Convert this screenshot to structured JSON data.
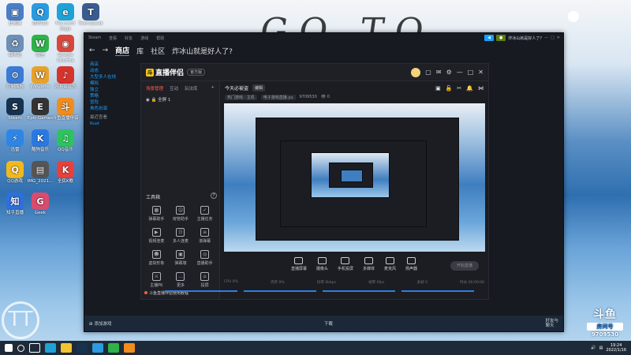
{
  "desktop": {
    "icons": [
      {
        "label": "此电脑",
        "color": "#4a7ec8",
        "glyph": "▣"
      },
      {
        "label": "腾讯QQ",
        "color": "#2a9be0",
        "glyph": "Q"
      },
      {
        "label": "Microsoft Edge",
        "color": "#1fa2d6",
        "glyph": "e"
      },
      {
        "label": "TeamSpeak",
        "color": "#3b5b8f",
        "glyph": "T"
      },
      {
        "label": "回收站",
        "color": "#6c8fb5",
        "glyph": "♻"
      },
      {
        "label": "微信",
        "color": "#2fb24a",
        "glyph": "W"
      },
      {
        "label": "Google Chrome",
        "color": "#d9463b",
        "glyph": "◉"
      },
      {
        "label": "控制面板",
        "color": "#3a7bd5",
        "glyph": "⚙"
      },
      {
        "label": "WeGame",
        "color": "#e8a22a",
        "glyph": "W"
      },
      {
        "label": "网易云音乐",
        "color": "#d6332d",
        "glyph": "♪"
      },
      {
        "label": "Steam",
        "color": "#17324f",
        "glyph": "S"
      },
      {
        "label": "Epic Games",
        "color": "#333",
        "glyph": "E"
      },
      {
        "label": "斗鱼直播伴侣",
        "color": "#f08d1f",
        "glyph": "斗"
      },
      {
        "label": "迅雷",
        "color": "#2d86e6",
        "glyph": "⚡"
      },
      {
        "label": "酷狗音乐",
        "color": "#2b79e0",
        "glyph": "K"
      },
      {
        "label": "QQ音乐",
        "color": "#2ec35e",
        "glyph": "♫"
      },
      {
        "label": "QQ游戏",
        "color": "#f2b81c",
        "glyph": "Q"
      },
      {
        "label": "IMG_2021...",
        "color": "#555",
        "glyph": "▤"
      },
      {
        "label": "全民K歌",
        "color": "#e8413b",
        "glyph": "K"
      },
      {
        "label": "知乎直播",
        "color": "#2d6fdc",
        "glyph": "知"
      },
      {
        "label": "Geek",
        "color": "#d94c6e",
        "glyph": "G"
      }
    ],
    "graffiti": "GO TO",
    "watermark": "TT"
  },
  "steam": {
    "menu": [
      "Steam",
      "查看",
      "好友",
      "游戏",
      "帮助"
    ],
    "notify": "炸冰山就是好人了?",
    "nav": {
      "store": "商店",
      "library": "库",
      "community": "社区",
      "user": "炸冰山就是好人了?"
    },
    "side_links": [
      "商店",
      "动态",
      "大型多人在线",
      "模拟",
      "独立",
      "策略",
      "冒险",
      "角色扮演"
    ],
    "side_header": "最近查看",
    "side_recent": "Rust",
    "add_game": "添加游戏",
    "downloads": "下载",
    "friends": "好友与\n聊天"
  },
  "app": {
    "name": "直播伴侣",
    "version": "官方版",
    "scene_tabs": [
      "场景管理",
      "互动",
      "玩法库"
    ],
    "scene_item": "全屏 1",
    "live_title": "今天必被盗",
    "edit_label": "编辑",
    "category": "热门游戏 · 主机",
    "room_label": "电子游戏直播.yu",
    "room_id": "9709530",
    "viewers": "0",
    "tools_title": "工具箱",
    "tools": [
      {
        "label": "弹幕助手",
        "g": "▦"
      },
      {
        "label": "房管助手",
        "g": "☺"
      },
      {
        "label": "主播任务",
        "g": "✓"
      },
      {
        "label": "视频连麦",
        "g": "▶"
      },
      {
        "label": "多人连麦",
        "g": "☷"
      },
      {
        "label": "滚弹幕",
        "g": "≡"
      },
      {
        "label": "虚拟形象",
        "g": "☻"
      },
      {
        "label": "弹幕墙",
        "g": "▣"
      },
      {
        "label": "直播助手",
        "g": "◎"
      },
      {
        "label": "主播PK",
        "g": "⚔"
      },
      {
        "label": "更多",
        "g": "…"
      },
      {
        "label": "投屏",
        "g": "⌂"
      }
    ],
    "notice": "斗鱼直播伴侣使用教程",
    "controls": [
      "直播屏幕",
      "摄像头",
      "手机投屏",
      "多媒体",
      "麦克风",
      "扬声器"
    ],
    "golive": "开始直播",
    "stats": [
      "CPU 0%",
      "内存 0%",
      "码率 0kbps",
      "帧率 0fps",
      "丢帧 0",
      "时长 00:00:00"
    ]
  },
  "taskbar": {
    "time": "19:24",
    "date": "2022/1/16"
  },
  "douyu": {
    "logo": "斗鱼",
    "sub": "房间号",
    "room": "9709530"
  }
}
